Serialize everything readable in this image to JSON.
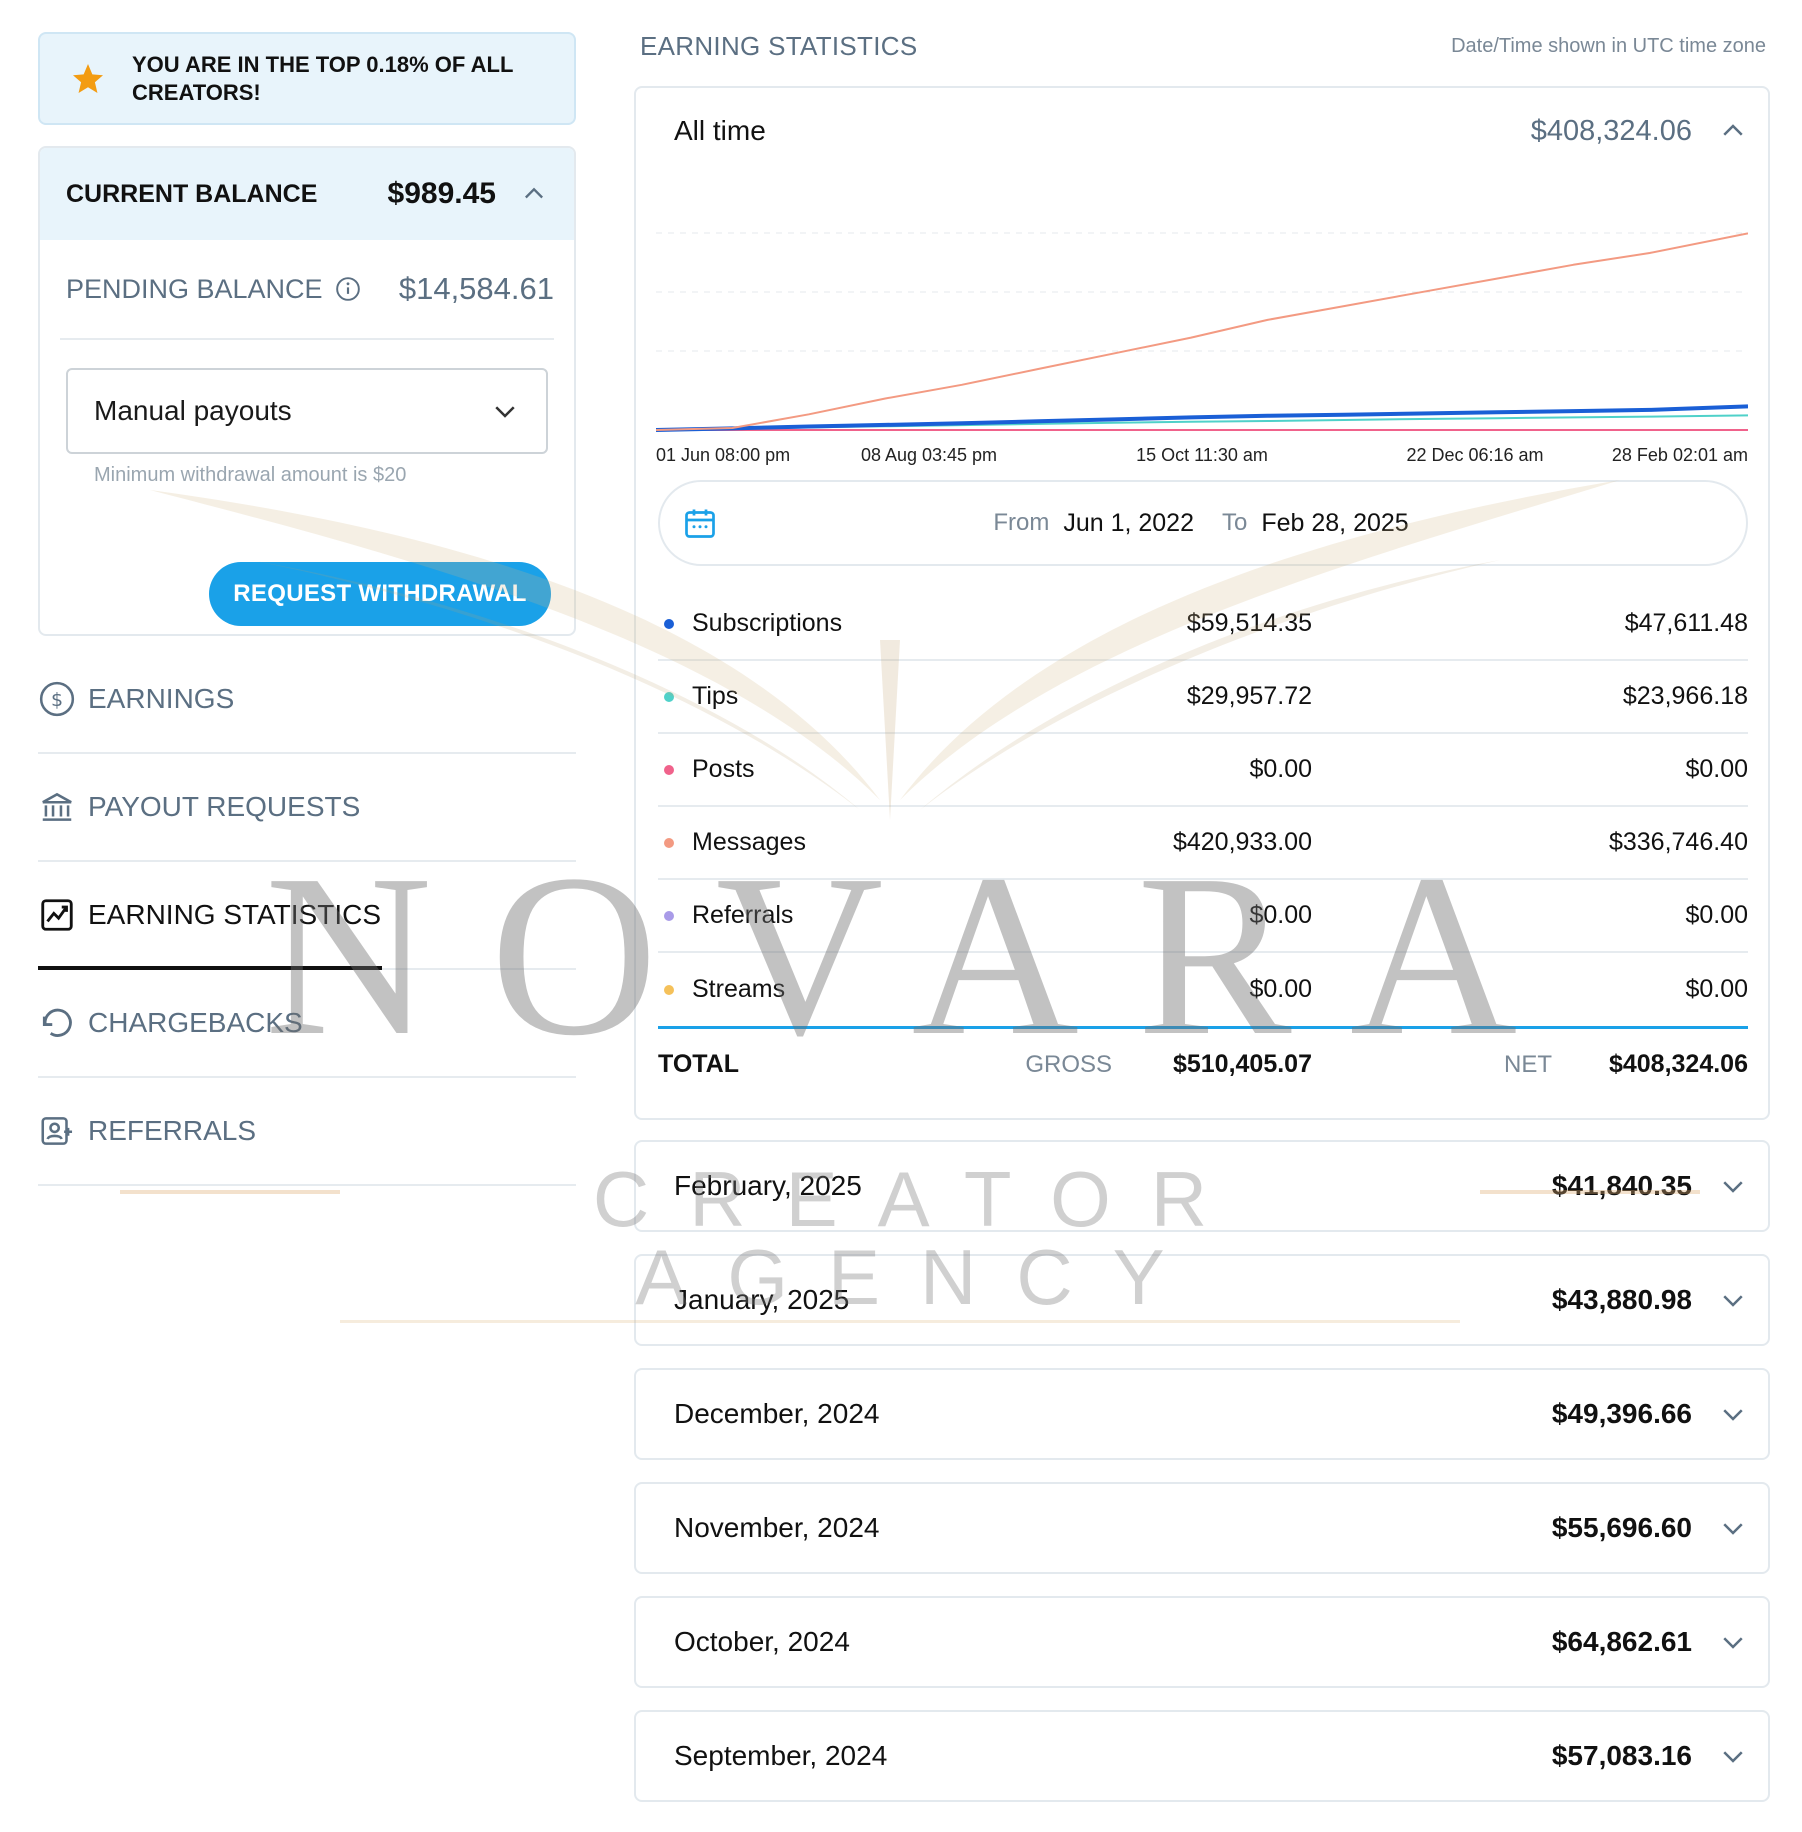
{
  "banner": {
    "text": "YOU ARE IN THE TOP 0.18% OF ALL CREATORS!"
  },
  "balance": {
    "current_label": "CURRENT BALANCE",
    "current_amount": "$989.45",
    "pending_label": "PENDING BALANCE",
    "pending_amount": "$14,584.61",
    "payout_method": "Manual payouts",
    "min_note": "Minimum withdrawal amount is $20",
    "withdraw_label": "REQUEST WITHDRAWAL"
  },
  "nav": {
    "items": [
      {
        "label": "EARNINGS",
        "icon": "dollar-circle-icon"
      },
      {
        "label": "PAYOUT REQUESTS",
        "icon": "bank-icon"
      },
      {
        "label": "EARNING STATISTICS",
        "icon": "chart-icon"
      },
      {
        "label": "CHARGEBACKS",
        "icon": "undo-icon"
      },
      {
        "label": "REFERRALS",
        "icon": "referral-icon"
      }
    ],
    "active": "EARNING STATISTICS"
  },
  "stats": {
    "title": "EARNING STATISTICS",
    "timezone_note": "Date/Time shown in UTC time zone",
    "period_label": "All time",
    "period_total": "$408,324.06",
    "range": {
      "from_label": "From",
      "from": "Jun 1, 2022",
      "to_label": "To",
      "to": "Feb 28, 2025"
    },
    "rows": [
      {
        "name": "Subscriptions",
        "gross": "$59,514.35",
        "net": "$47,611.48",
        "color": "#1a5fd6"
      },
      {
        "name": "Tips",
        "gross": "$29,957.72",
        "net": "$23,966.18",
        "color": "#4fd1c9"
      },
      {
        "name": "Posts",
        "gross": "$0.00",
        "net": "$0.00",
        "color": "#f0628b"
      },
      {
        "name": "Messages",
        "gross": "$420,933.00",
        "net": "$336,746.40",
        "color": "#f39a82"
      },
      {
        "name": "Referrals",
        "gross": "$0.00",
        "net": "$0.00",
        "color": "#a99be8"
      },
      {
        "name": "Streams",
        "gross": "$0.00",
        "net": "$0.00",
        "color": "#f5c15a"
      }
    ],
    "total": {
      "label": "TOTAL",
      "gross_label": "GROSS",
      "gross": "$510,405.07",
      "net_label": "NET",
      "net": "$408,324.06"
    }
  },
  "chart_data": {
    "type": "line",
    "x_ticks": [
      "01 Jun 08:00 pm",
      "08 Aug 03:45 pm",
      "15 Oct 11:30 am",
      "22 Dec 06:16 am",
      "28 Feb 02:01 am"
    ],
    "x": [
      0,
      0.07,
      0.14,
      0.21,
      0.28,
      0.35,
      0.42,
      0.49,
      0.56,
      0.63,
      0.7,
      0.77,
      0.84,
      0.91,
      1.0
    ],
    "ylim": [
      0,
      60000
    ],
    "grid": true,
    "series": [
      {
        "name": "Messages",
        "color": "#f39a82",
        "values": [
          0,
          500,
          4000,
          8000,
          11500,
          15500,
          19500,
          23500,
          28000,
          31500,
          35000,
          38500,
          42000,
          45000,
          50000
        ]
      },
      {
        "name": "Subscriptions",
        "color": "#1a5fd6",
        "values": [
          0,
          400,
          900,
          1300,
          1700,
          2200,
          2700,
          3200,
          3600,
          3900,
          4200,
          4500,
          4800,
          5100,
          6000
        ]
      },
      {
        "name": "Tips",
        "color": "#4fd1c9",
        "values": [
          0,
          300,
          650,
          950,
          1250,
          1550,
          1850,
          2100,
          2300,
          2550,
          2800,
          3000,
          3200,
          3400,
          3700
        ]
      },
      {
        "name": "Posts",
        "color": "#f0628b",
        "values": [
          0,
          0,
          0,
          0,
          0,
          0,
          0,
          0,
          0,
          0,
          0,
          0,
          0,
          0,
          0
        ]
      }
    ]
  },
  "months": [
    {
      "label": "February, 2025",
      "amount": "$41,840.35"
    },
    {
      "label": "January, 2025",
      "amount": "$43,880.98"
    },
    {
      "label": "December, 2024",
      "amount": "$49,396.66"
    },
    {
      "label": "November, 2024",
      "amount": "$55,696.60"
    },
    {
      "label": "October, 2024",
      "amount": "$64,862.61"
    },
    {
      "label": "September, 2024",
      "amount": "$57,083.16"
    }
  ],
  "watermark": {
    "brand": "NOVARA",
    "sub": "CREATOR AGENCY"
  }
}
